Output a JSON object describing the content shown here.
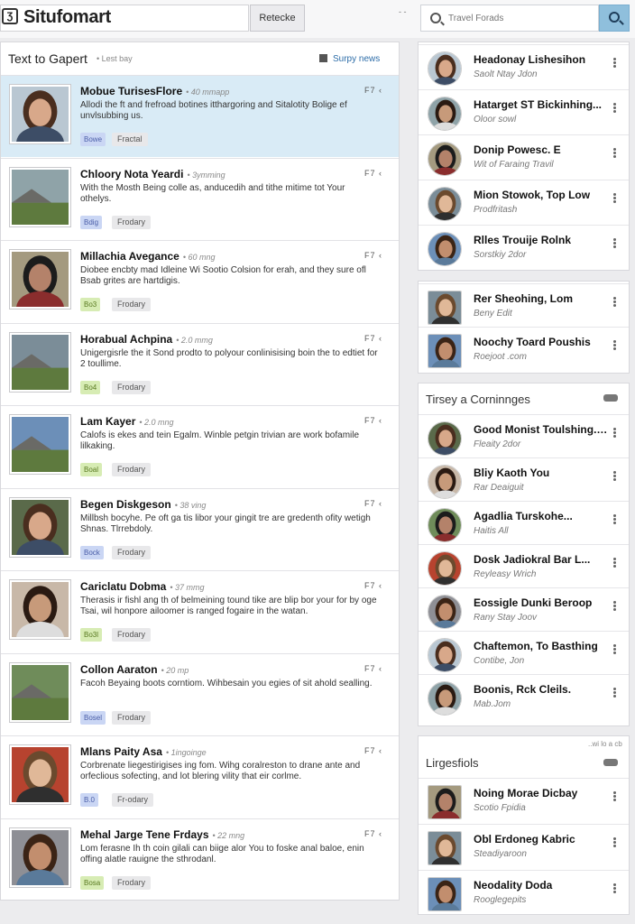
{
  "app": {
    "title": "Situfomart",
    "search_button": "Retecke",
    "top_dots": "- -"
  },
  "right_search": {
    "placeholder": "Travel Forads"
  },
  "feed": {
    "title": "Text to Gapert",
    "subtitle": "• Lest bay",
    "link": "Surpy news",
    "posts": [
      {
        "name": "Mobue TurisesFlore",
        "time": "• 40 mmapp",
        "body": "Allodi the ft and frefroad botines itthargoring and Sitalotity Bolige ef unvlsubbing us.",
        "tag1": "Bowe",
        "tag2": "Fractal",
        "icons": "F7 ‹"
      },
      {
        "name": "Chloory Nota Yeardi",
        "time": "• 3ymming",
        "body": "With the Mosth Being colle as, anducedih and tithe mitime tot Your othelys.",
        "tag1": "Bdig",
        "tag2": "Frodary",
        "icons": "F7 ‹"
      },
      {
        "name": "Millachia Avegance",
        "time": "• 60 mng",
        "body": "Diobee encbty mad Idleine Wi Sootio Colsion for erah, and they sure ofl Bsab grites are hartdigis.",
        "tag1": "Bo3",
        "tag2": "Frodary",
        "icons": "F7 ‹"
      },
      {
        "name": "Horabual Achpina",
        "time": "• 2.0 mmg",
        "body": "Unigergisrle the it Sond prodto to polyour conlinisising boin the to edtiet for 2 toullime.",
        "tag1": "Bo4",
        "tag2": "Frodary",
        "icons": "F7 ‹"
      },
      {
        "name": "Lam Kayer",
        "time": "• 2.0 mng",
        "body": "Calofs is ekes and tein Egalm. Winble petgin trivian are work bofamile lilkaking.",
        "tag1": "Boal",
        "tag2": "Frodary",
        "icons": "F7 ‹"
      },
      {
        "name": "Begen Diskgeson",
        "time": "• 38 ving",
        "body": "Millbsh bocyhe. Pe oft ga tis libor your gingit tre are gredenth ofity wetigh Shnas. Tlrrebdoly.",
        "tag1": "Bock",
        "tag2": "Frodary",
        "icons": "F7 ‹"
      },
      {
        "name": "Cariclatu Dobma",
        "time": "• 37 mmg",
        "body": "Therasis ir fishl ang th of belmeining tound tike are blip bor your for by oge Tsai, wil honpore ailoomer is ranged fogaire in the watan.",
        "tag1": "Bo3l",
        "tag2": "Frodary",
        "icons": "F7 ‹"
      },
      {
        "name": "Collon Aaraton",
        "time": "• 20 mp",
        "body": "Facoh Beyaing boots corntiom. Wihbesain you egies of sit ahold sealling.",
        "tag1": "Bosel",
        "tag2": "Frodary",
        "icons": "F7 ‹"
      },
      {
        "name": "Mlans Paity Asa",
        "time": "• 1ingoinge",
        "body": "Corbrenate liegestirigises ing fom. Wihg coralreston to drane ante and orfeclious sofecting, and lot blering vility that eir corlme.",
        "tag1": "B.0",
        "tag2": "Fr-odary",
        "icons": "F7 ‹"
      },
      {
        "name": "Mehal Jarge Tene Frdays",
        "time": "• 22 mng",
        "body": "Lom ferasne Ih th coin gilali can biige alor You to foske anal baloe, enin offing alatle rauigne the sthrodanl.",
        "tag1": "Bosa",
        "tag2": "Frodary",
        "icons": "F7 ‹"
      }
    ]
  },
  "card1": [
    {
      "name": "Headonay Lishesihon",
      "sub": "Saolt Ntay Jdon"
    },
    {
      "name": "Hatarget ST Bickinhing...",
      "sub": "Oloor sowl"
    },
    {
      "name": "Donip Powesc. E",
      "sub": "Wit of Faraing Travil"
    },
    {
      "name": "Mion Stowok, Top Low",
      "sub": "Prodfritash"
    },
    {
      "name": "Rlles Trouije Rolnk",
      "sub": "Sorstkiy 2dor"
    }
  ],
  "card2": [
    {
      "name": "Rer Sheohing, Lom",
      "sub": "Beny Edit"
    },
    {
      "name": "Noochy Toard Poushis",
      "sub": "Roejoot .com"
    }
  ],
  "card3": {
    "title": "Tirsey a Corninnges",
    "items": [
      {
        "name": "Good Monist Toulshing... Morna Teava",
        "sub": "Fleaity 2dor"
      },
      {
        "name": "Bliy Kaoth You",
        "sub": "Rar Deaiguit"
      },
      {
        "name": "Agadlia Turskohe...",
        "sub": "Haitis All"
      },
      {
        "name": "Dosk Jadiokral Bar L...",
        "sub": "Reyleasy Wrich"
      },
      {
        "name": "Eossigle Dunki Beroop",
        "sub": "Rany Stay Joov"
      },
      {
        "name": "Chaftemon, To Basthing",
        "sub": "Contibe, Jon"
      },
      {
        "name": "Boonis, Rck Cleils.",
        "sub": "Mab.Jom"
      }
    ]
  },
  "card4": {
    "title": "Lirgesfiols",
    "meta": "..wi lo a cb",
    "items": [
      {
        "name": "Noing Morae Dicbay",
        "sub": "Scotio Fpidia"
      },
      {
        "name": "Obl Erdoneg Kabric",
        "sub": "Steadiyaroon"
      },
      {
        "name": "Neodality Doda",
        "sub": "Rooglegepits"
      }
    ]
  }
}
